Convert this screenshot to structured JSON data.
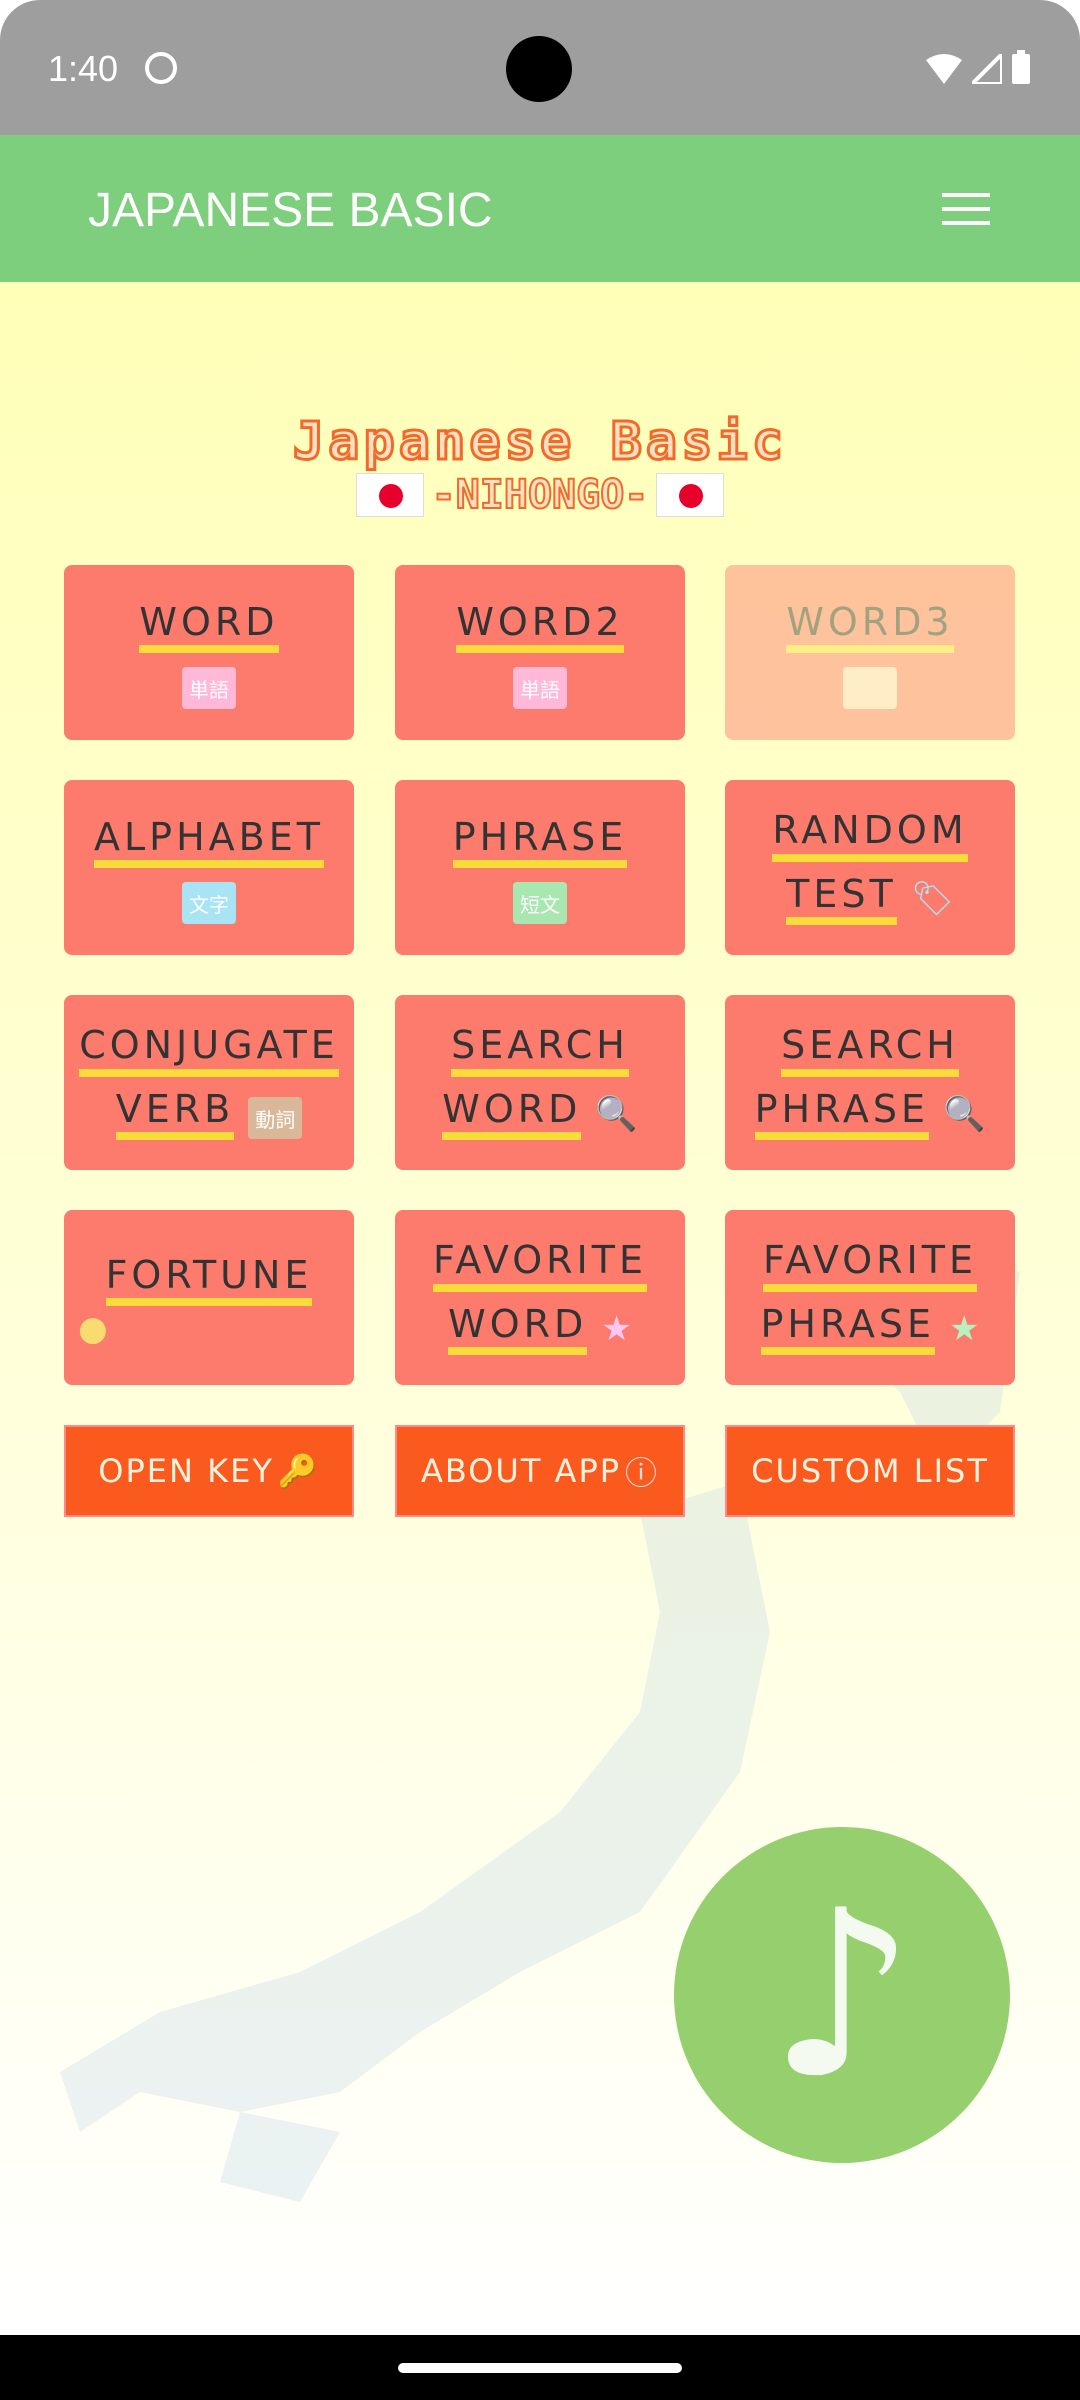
{
  "status_bar": {
    "time": "1:40",
    "icons": [
      "cat-notification-icon",
      "wifi-icon",
      "signal-icon",
      "battery-icon"
    ]
  },
  "app_bar": {
    "title": "JAPANESE BASIC",
    "menu_icon": "hamburger-menu-icon"
  },
  "logo": {
    "line1": "Japanese Basic",
    "line2": "-NIHONGO-"
  },
  "tiles": [
    {
      "lines": [
        "WORD"
      ],
      "icon": "book-icon",
      "icon_text": "単語",
      "icon_color": "#ffb8d8",
      "enabled": true
    },
    {
      "lines": [
        "WORD2"
      ],
      "icon": "book-icon",
      "icon_text": "単語",
      "icon_color": "#ffb8d8",
      "enabled": true
    },
    {
      "lines": [
        "WORD3"
      ],
      "icon": "book-icon",
      "icon_text": "",
      "icon_color": "#ffd8c8",
      "enabled": false
    },
    {
      "lines": [
        "ALPHABET"
      ],
      "icon": "book-icon",
      "icon_text": "文字",
      "icon_color": "#a8e4f4",
      "enabled": true
    },
    {
      "lines": [
        "PHRASE"
      ],
      "icon": "book-icon",
      "icon_text": "短文",
      "icon_color": "#a8e8b0",
      "enabled": true
    },
    {
      "lines": [
        "RANDOM",
        "TEST"
      ],
      "icon": "tag-icon",
      "icon_color": "#a8e4f4",
      "enabled": true
    },
    {
      "lines": [
        "CONJUGATE",
        "VERB"
      ],
      "icon": "book-icon",
      "icon_text": "動詞",
      "icon_color": "#d8b898",
      "enabled": true
    },
    {
      "lines": [
        "SEARCH",
        "WORD"
      ],
      "icon": "search-icon",
      "icon_color": "#ffc8f0",
      "enabled": true
    },
    {
      "lines": [
        "SEARCH",
        "PHRASE"
      ],
      "icon": "search-icon",
      "icon_color": "#b8f0c0",
      "enabled": true
    },
    {
      "lines": [
        "FORTUNE"
      ],
      "icon": "mango-icon",
      "icon_color": "#f8dc70",
      "enabled": true
    },
    {
      "lines": [
        "FAVORITE",
        "WORD"
      ],
      "icon": "star-icon",
      "icon_color": "#ffc8f0",
      "enabled": true
    },
    {
      "lines": [
        "FAVORITE",
        "PHRASE"
      ],
      "icon": "star-icon",
      "icon_color": "#b8f0c0",
      "enabled": true
    }
  ],
  "buttons": [
    {
      "label": "OPEN KEY",
      "icon": "key-icon"
    },
    {
      "label": "ABOUT APP",
      "icon": "help-circle-icon"
    },
    {
      "label": "CUSTOM LIST",
      "icon": ""
    }
  ],
  "fab": {
    "icon": "music-note-icon",
    "glyph": "♪"
  },
  "colors": {
    "app_bar": "#7dce7d",
    "tile": "#fd7b6d",
    "button": "#fb5a1e",
    "underline": "#f9dc3c",
    "fab": "#96cf6e"
  }
}
